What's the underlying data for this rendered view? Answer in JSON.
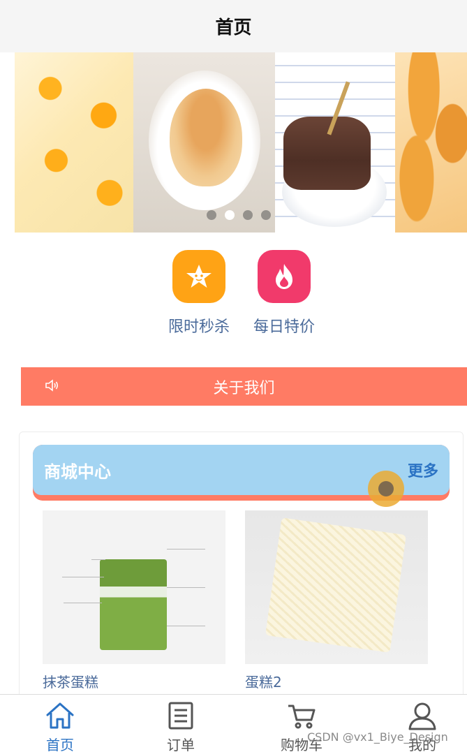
{
  "header": {
    "title": "首页"
  },
  "banner": {
    "slides": [
      "mango-pudding",
      "sesame-bun",
      "chocolate-cake",
      "bread-rolls"
    ],
    "active_dot": 1,
    "dot_count": 4
  },
  "quick_actions": [
    {
      "label": "限时秒杀",
      "icon": "star-icon",
      "color": "#ffa315"
    },
    {
      "label": "每日特价",
      "icon": "flame-icon",
      "color": "#f13a6b"
    }
  ],
  "about": {
    "label": "关于我们",
    "icon": "speaker-icon",
    "color": "#ff7b64"
  },
  "mall": {
    "title": "商城中心",
    "more": "更多",
    "header_color": "#a3d4f2"
  },
  "products": [
    {
      "name": "抹茶蛋糕"
    },
    {
      "name": "蛋糕2"
    }
  ],
  "tabbar": {
    "items": [
      {
        "label": "首页",
        "icon": "home-icon",
        "active": true
      },
      {
        "label": "订单",
        "icon": "order-icon",
        "active": false
      },
      {
        "label": "购物车",
        "icon": "cart-icon",
        "active": false
      },
      {
        "label": "我的",
        "icon": "user-icon",
        "active": false
      }
    ],
    "active_color": "#2b73c4"
  },
  "watermark": "CSDN @vx1_Biye_Design"
}
